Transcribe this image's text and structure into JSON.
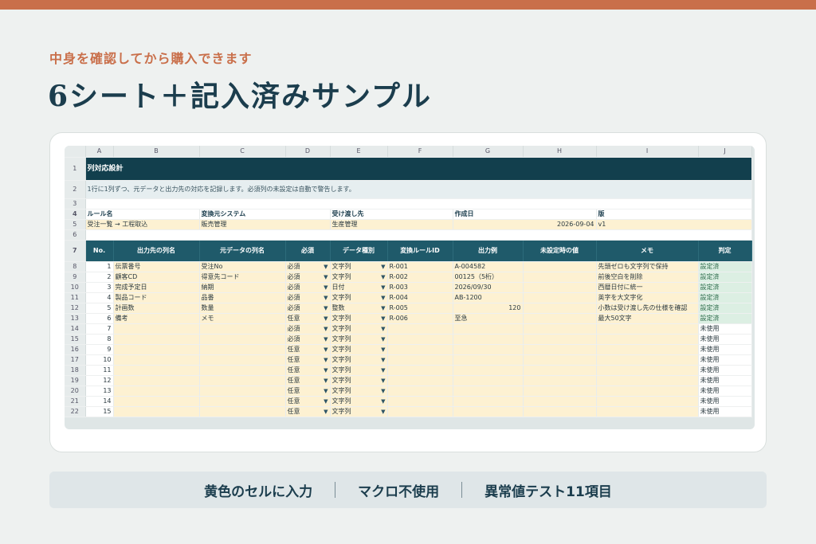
{
  "kicker": "中身を確認してから購入できます",
  "headline": "6シート＋記入済みサンプル",
  "sheet": {
    "columns": [
      "A",
      "B",
      "C",
      "D",
      "E",
      "F",
      "G",
      "H",
      "I",
      "J"
    ],
    "title": "列対応設計",
    "description": "1行に1列ずつ、元データと出力先の対応を記録します。必須列の未設定は自動で警告します。",
    "meta_headers": [
      "ルール名",
      "変換元システム",
      "受け渡し先",
      "作成日",
      "版"
    ],
    "meta_values": [
      "受注一覧 → 工程取込",
      "販売管理",
      "生産管理",
      "2026-09-04",
      "v1"
    ],
    "headers": [
      "No.",
      "出力先の列名",
      "元データの列名",
      "必須",
      "データ種別",
      "変換ルールID",
      "出力例",
      "未設定時の値",
      "メモ",
      "判定"
    ],
    "rows": [
      {
        "no": "1",
        "out": "伝票番号",
        "src": "受注No",
        "req": "必須",
        "type": "文字列",
        "rule": "R-001",
        "ex": "A-004582",
        "def": "",
        "memo": "先頭ゼロも文字列で保持",
        "judge": "設定済"
      },
      {
        "no": "2",
        "out": "顧客CD",
        "src": "得意先コード",
        "req": "必須",
        "type": "文字列",
        "rule": "R-002",
        "ex": "00125（5桁）",
        "def": "",
        "memo": "前後空白を削除",
        "judge": "設定済"
      },
      {
        "no": "3",
        "out": "完成予定日",
        "src": "納期",
        "req": "必須",
        "type": "日付",
        "rule": "R-003",
        "ex": "2026/09/30",
        "def": "",
        "memo": "西暦日付に統一",
        "judge": "設定済"
      },
      {
        "no": "4",
        "out": "製品コード",
        "src": "品番",
        "req": "必須",
        "type": "文字列",
        "rule": "R-004",
        "ex": "AB-1200",
        "def": "",
        "memo": "英字を大文字化",
        "judge": "設定済"
      },
      {
        "no": "5",
        "out": "計画数",
        "src": "数量",
        "req": "必須",
        "type": "整数",
        "rule": "R-005",
        "ex": "120",
        "def": "",
        "memo": "小数は受け渡し先の仕様を確認",
        "judge": "設定済"
      },
      {
        "no": "6",
        "out": "備考",
        "src": "メモ",
        "req": "任意",
        "type": "文字列",
        "rule": "R-006",
        "ex": "至急",
        "def": "",
        "memo": "最大50文字",
        "judge": "設定済"
      },
      {
        "no": "7",
        "out": "",
        "src": "",
        "req": "必須",
        "type": "文字列",
        "rule": "",
        "ex": "",
        "def": "",
        "memo": "",
        "judge": "未使用"
      },
      {
        "no": "8",
        "out": "",
        "src": "",
        "req": "必須",
        "type": "文字列",
        "rule": "",
        "ex": "",
        "def": "",
        "memo": "",
        "judge": "未使用"
      },
      {
        "no": "9",
        "out": "",
        "src": "",
        "req": "任意",
        "type": "文字列",
        "rule": "",
        "ex": "",
        "def": "",
        "memo": "",
        "judge": "未使用"
      },
      {
        "no": "10",
        "out": "",
        "src": "",
        "req": "任意",
        "type": "文字列",
        "rule": "",
        "ex": "",
        "def": "",
        "memo": "",
        "judge": "未使用"
      },
      {
        "no": "11",
        "out": "",
        "src": "",
        "req": "任意",
        "type": "文字列",
        "rule": "",
        "ex": "",
        "def": "",
        "memo": "",
        "judge": "未使用"
      },
      {
        "no": "12",
        "out": "",
        "src": "",
        "req": "任意",
        "type": "文字列",
        "rule": "",
        "ex": "",
        "def": "",
        "memo": "",
        "judge": "未使用"
      },
      {
        "no": "13",
        "out": "",
        "src": "",
        "req": "任意",
        "type": "文字列",
        "rule": "",
        "ex": "",
        "def": "",
        "memo": "",
        "judge": "未使用"
      },
      {
        "no": "14",
        "out": "",
        "src": "",
        "req": "任意",
        "type": "文字列",
        "rule": "",
        "ex": "",
        "def": "",
        "memo": "",
        "judge": "未使用"
      },
      {
        "no": "15",
        "out": "",
        "src": "",
        "req": "任意",
        "type": "文字列",
        "rule": "",
        "ex": "",
        "def": "",
        "memo": "",
        "judge": "未使用"
      }
    ]
  },
  "features": [
    "黄色のセルに入力",
    "マクロ不使用",
    "異常値テスト11項目"
  ],
  "colors": {
    "accent": "#c96f4a",
    "navy": "#123f4d",
    "teal_header": "#1f5a6a",
    "input_yellow": "#fdf1d2",
    "ok_green": "#dcefe3"
  }
}
